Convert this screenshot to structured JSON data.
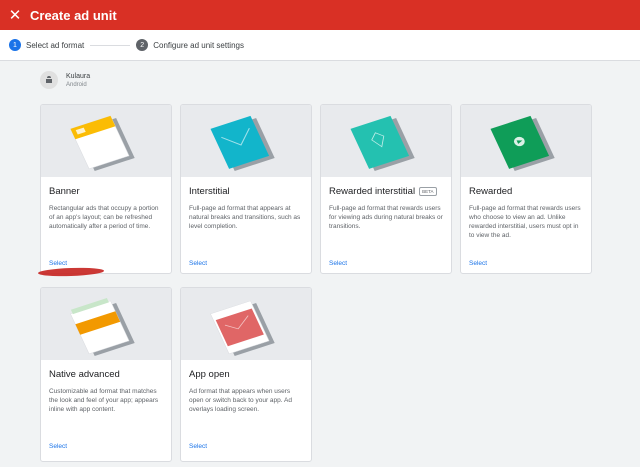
{
  "appbar": {
    "close_label": "✕",
    "title": "Create ad unit"
  },
  "stepper": {
    "steps": [
      {
        "num": "1",
        "label": "Select ad format"
      },
      {
        "num": "2",
        "label": "Configure ad unit settings"
      }
    ]
  },
  "app": {
    "name": "Kulaura",
    "platform": "Android"
  },
  "cards": [
    {
      "title": "Banner",
      "desc": "Rectangular ads that occupy a portion of an app's layout; can be refreshed automatically after a period of time.",
      "select": "Select",
      "accent": "#fbbc04"
    },
    {
      "title": "Interstitial",
      "desc": "Full-page ad format that appears at natural breaks and transitions, such as level completion.",
      "select": "Select",
      "accent": "#12b5cb"
    },
    {
      "title": "Rewarded interstitial",
      "badge": "BETA",
      "desc": "Full-page ad format that rewards users for viewing ads during natural breaks or transitions.",
      "select": "Select",
      "accent": "#24c1b0"
    },
    {
      "title": "Rewarded",
      "desc": "Full-page ad format that rewards users who choose to view an ad. Unlike rewarded interstitial, users must opt in to view the ad.",
      "select": "Select",
      "accent": "#0f9d58"
    },
    {
      "title": "Native advanced",
      "desc": "Customizable ad format that matches the look and feel of your app; appears inline with app content.",
      "select": "Select",
      "accent": "#f29900"
    },
    {
      "title": "App open",
      "desc": "Ad format that appears when users open or switch back to your app. Ad overlays loading screen.",
      "select": "Select",
      "accent": "#e06666"
    }
  ]
}
